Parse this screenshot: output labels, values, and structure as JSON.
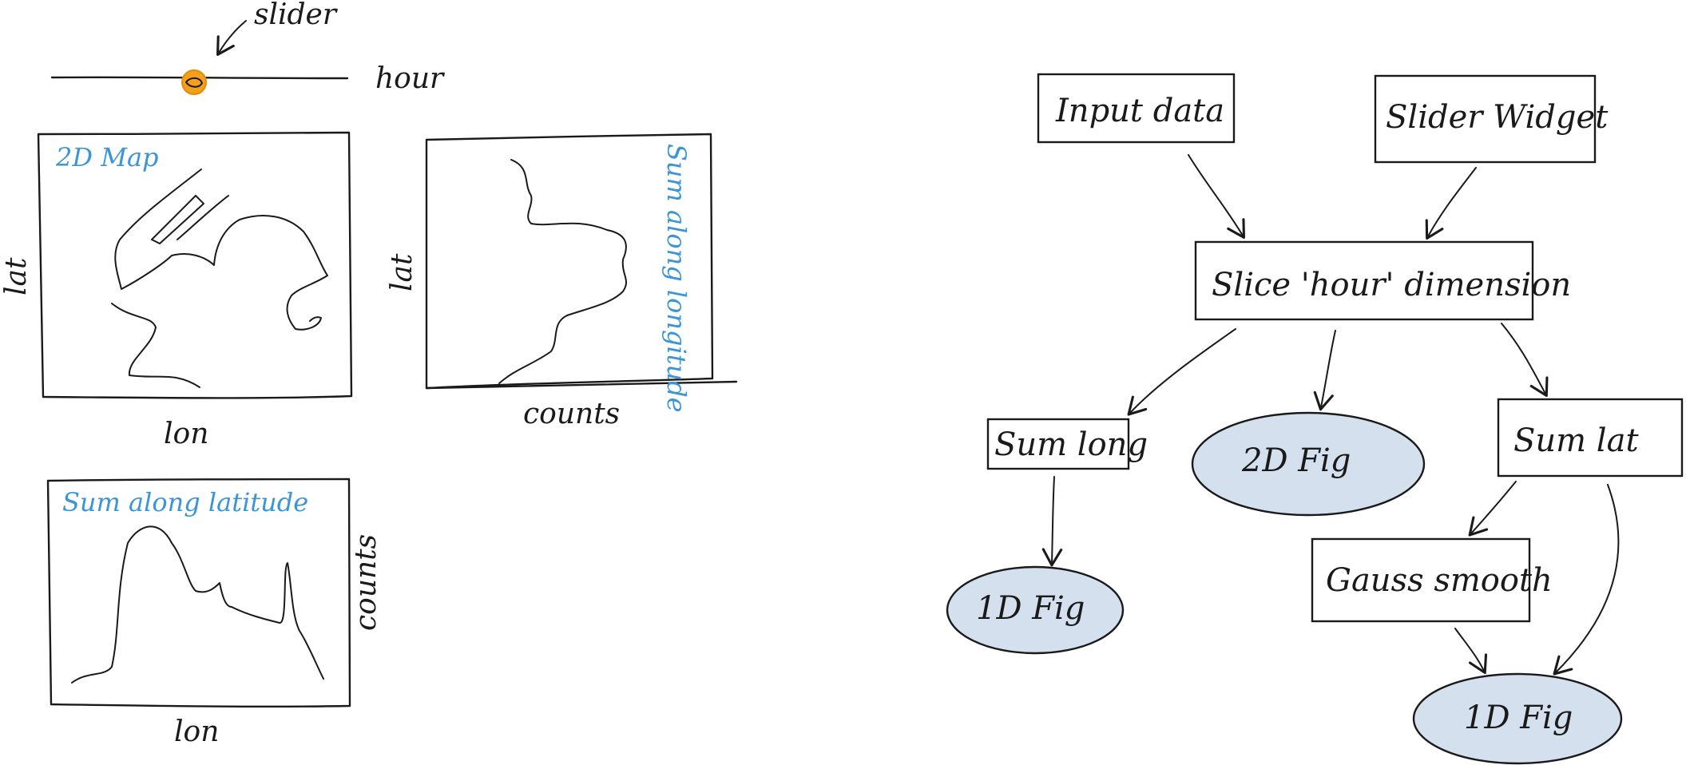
{
  "sketch": {
    "slider_label": "slider",
    "hour_label": "hour",
    "map_title": "2D Map",
    "map_ylabel": "lat",
    "map_xlabel": "lon",
    "lon_sum_title": "Sum along longitude",
    "lon_sum_ylabel": "lat",
    "lon_sum_xlabel": "counts",
    "lat_sum_title": "Sum along latitude",
    "lat_sum_ylabel": "counts",
    "lat_sum_xlabel": "lon",
    "colors": {
      "ink": "#1a1a1a",
      "blue_text": "#3b95d6",
      "slider_knob": "#f5a01a"
    }
  },
  "flow": {
    "input_data": "Input data",
    "slider_widget": "Slider Widget",
    "slice_hour": "Slice 'hour' dimension",
    "sum_long": "Sum long",
    "fig_2d": "2D Fig",
    "sum_lat": "Sum lat",
    "fig_1d_left": "1D Fig",
    "gauss_smooth": "Gauss smooth",
    "fig_1d_right": "1D Fig",
    "colors": {
      "ellipse_fill": "#d5e0ee"
    }
  }
}
